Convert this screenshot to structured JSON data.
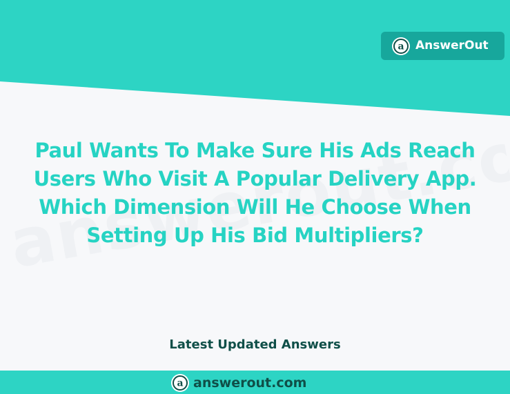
{
  "colors": {
    "teal_primary": "#2dd4c4",
    "teal_dark": "#17a79c",
    "headline_text": "#26d3c3",
    "dark_text": "#0f4f48",
    "background": "#f7f8fa"
  },
  "brand_badge": {
    "icon": "answerout-logo-icon",
    "name": "AnswerOut"
  },
  "headline": {
    "line1": "Paul Wants To Make Sure His Ads Reach",
    "line2": "Users Who Visit A Popular Delivery App.",
    "line3": "Which Dimension Will He Choose When",
    "line4": "Setting Up His Bid Multipliers?"
  },
  "watermark": {
    "text": "answerout.com"
  },
  "tagline": "Latest Updated Answers",
  "footer": {
    "icon": "answerout-logo-icon",
    "domain": "answerout.com"
  }
}
